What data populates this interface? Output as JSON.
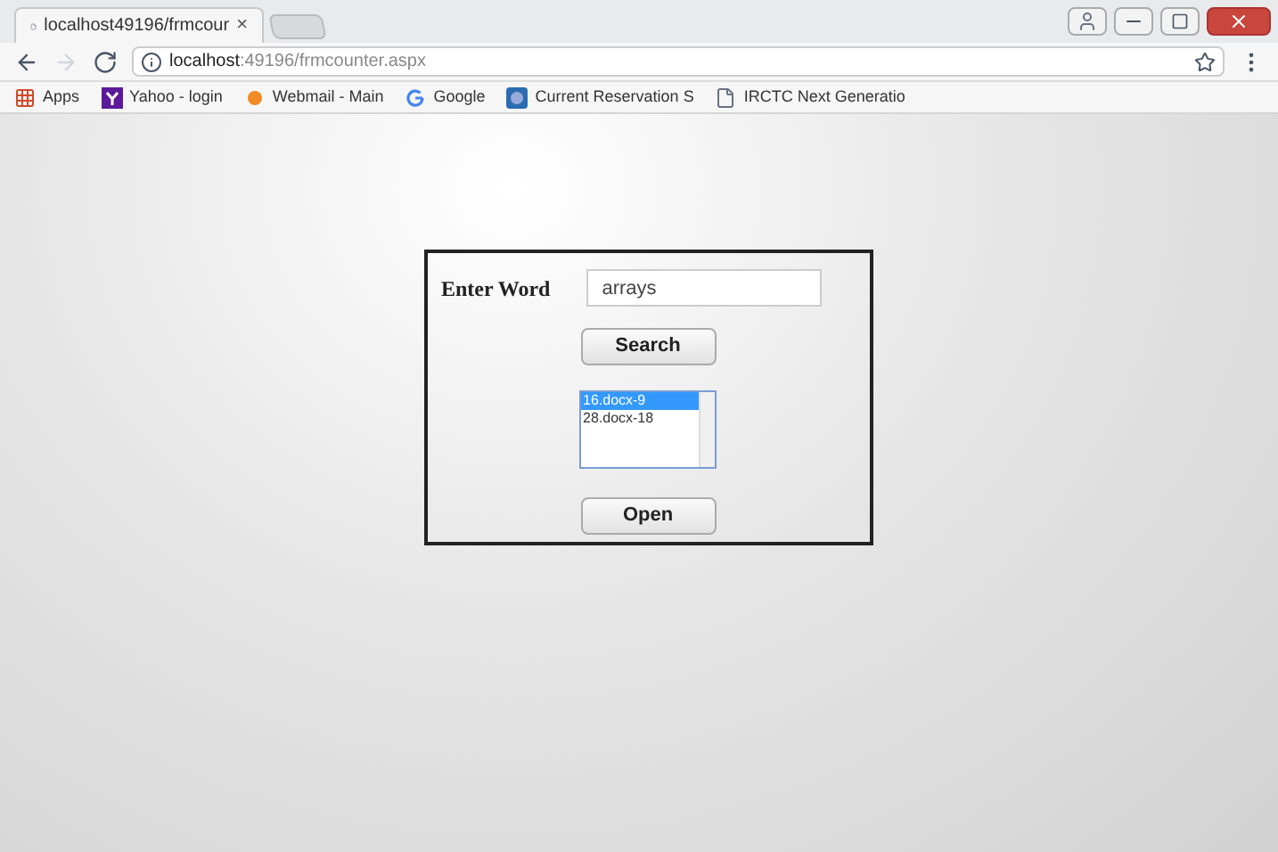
{
  "tab": {
    "title": "localhost49196/frmcour",
    "close": "×"
  },
  "address_bar": {
    "host": "localhost",
    "path": ":49196/frmcounter.aspx"
  },
  "bookmarks": [
    {
      "label": "Apps"
    },
    {
      "label": "Yahoo - login"
    },
    {
      "label": "Webmail - Main"
    },
    {
      "label": "Google"
    },
    {
      "label": "Current Reservation S"
    },
    {
      "label": "IRCTC Next Generatio"
    }
  ],
  "form": {
    "label": "Enter Word",
    "value": "arrays",
    "search_button": "Search",
    "open_button": "Open",
    "results": [
      {
        "label": "16.docx-9",
        "selected": true
      },
      {
        "label": "28.docx-18",
        "selected": false
      }
    ]
  }
}
